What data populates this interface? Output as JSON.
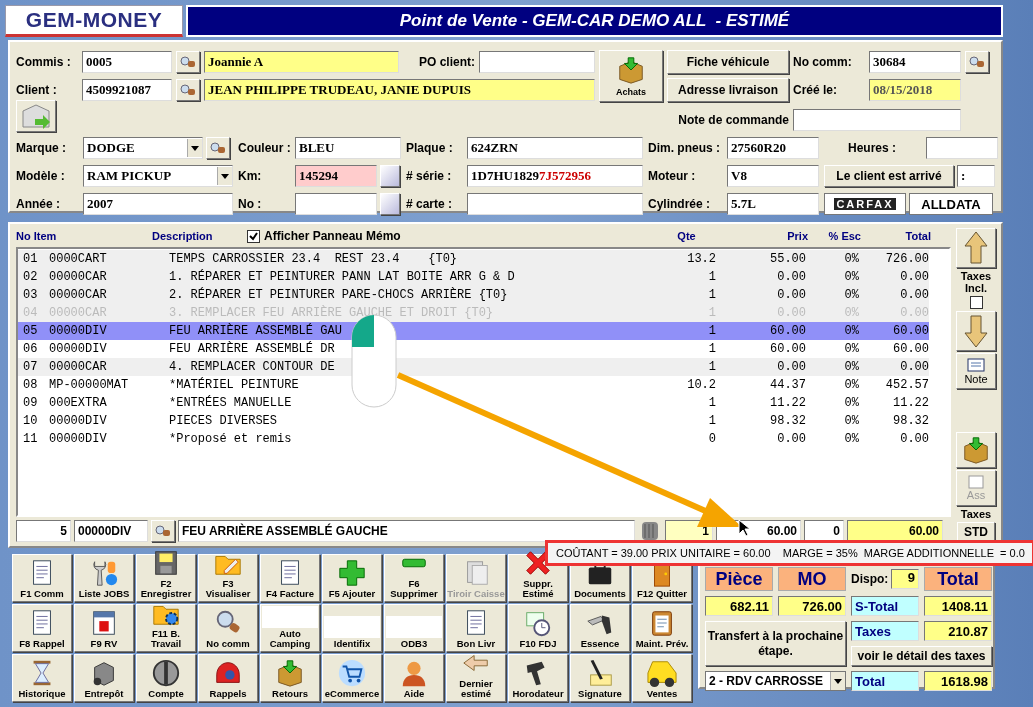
{
  "header": {
    "logo": "GEM-MONEY",
    "title": "Point de Vente - GEM-CAR DEMO ALL  - ESTIMÉ"
  },
  "order": {
    "commis": {
      "label": "Commis :",
      "code": "0005",
      "name": "Joannie A"
    },
    "po_client": {
      "label": "PO client:"
    },
    "client": {
      "label": "Client :",
      "code": "4509921087",
      "name": "JEAN PHILIPPE TRUDEAU, JANIE DUPUIS"
    },
    "achats": "Achats",
    "buttons": [
      "Fiche véhicule",
      "Adresse livraison"
    ],
    "no_comm": {
      "label": "No comm:",
      "value": "30684"
    },
    "created": {
      "label": "Créé le:",
      "value": "08/15/2018"
    },
    "note": {
      "label": "Note de commande"
    }
  },
  "vehicle": {
    "marque": {
      "label": "Marque :",
      "value": "DODGE"
    },
    "modele": {
      "label": "Modèle :",
      "value": "RAM PICKUP"
    },
    "annee": {
      "label": "Année :",
      "value": "2007"
    },
    "couleur": {
      "label": "Couleur :",
      "value": "BLEU"
    },
    "km": {
      "label": "Km:",
      "value": "145294"
    },
    "no": {
      "label": "No :"
    },
    "plaque": {
      "label": "Plaque :",
      "value": "624ZRN"
    },
    "serie": {
      "label": "# série :",
      "value": "1D7HU1829",
      "value_highlight": "7J572956"
    },
    "carte": {
      "label": "# carte :"
    },
    "pneus": {
      "label": "Dim. pneus :",
      "value": "27560R20"
    },
    "moteur": {
      "label": "Moteur :",
      "value": "V8"
    },
    "cylindree": {
      "label": "Cylindrée :",
      "value": "5.7L"
    },
    "heures": {
      "label": "Heures :"
    },
    "arrived_button": "Le client est arrivé",
    "arrived_field": ":",
    "logos": [
      "CARFAX",
      "ALLDATA"
    ]
  },
  "items": {
    "columns": [
      "No Item",
      "Description",
      "Qte",
      "Prix",
      "% Esc",
      "Total"
    ],
    "memo": {
      "label": "Afficher Panneau Mémo",
      "checked": true
    },
    "rows": [
      {
        "no": "01",
        "item": "0000CART",
        "desc": "TEMPS CARROSSIER 23.4  REST 23.4    {T0}",
        "qte": "13.2",
        "prix": "55.00",
        "esc": "0%",
        "total": "726.00",
        "shaded": true,
        "selected": false,
        "disabled": false
      },
      {
        "no": "02",
        "item": "00000CAR",
        "desc": "1. RÉPARER ET PEINTURER PANN LAT BOITE ARR G & D",
        "qte": "1",
        "prix": "0.00",
        "esc": "0%",
        "total": "0.00",
        "shaded": true,
        "selected": false,
        "disabled": false
      },
      {
        "no": "03",
        "item": "00000CAR",
        "desc": "2. RÉPARER ET PEINTURER PARE-CHOCS ARRIÈRE {T0}",
        "qte": "1",
        "prix": "0.00",
        "esc": "0%",
        "total": "0.00",
        "shaded": true,
        "selected": false,
        "disabled": false
      },
      {
        "no": "04",
        "item": "00000CAR",
        "desc": "3. REMPLACER FEU ARRIÈRE GAUCHE ET DROIT {T0}",
        "qte": "1",
        "prix": "0.00",
        "esc": "0%",
        "total": "0.00",
        "shaded": true,
        "selected": false,
        "disabled": true
      },
      {
        "no": "05",
        "item": "00000DIV",
        "desc": "FEU ARRIÈRE ASSEMBLÉ GAU",
        "qte": "1",
        "prix": "60.00",
        "esc": "0%",
        "total": "60.00",
        "shaded": false,
        "selected": true,
        "disabled": false
      },
      {
        "no": "06",
        "item": "00000DIV",
        "desc": "FEU ARRIÈRE ASSEMBLÉ DR",
        "qte": "1",
        "prix": "60.00",
        "esc": "0%",
        "total": "60.00",
        "shaded": false,
        "selected": false,
        "disabled": false
      },
      {
        "no": "07",
        "item": "00000CAR",
        "desc": "4. REMPLACER CONTOUR DE",
        "qte": "1",
        "prix": "0.00",
        "esc": "0%",
        "total": "0.00",
        "shaded": true,
        "selected": false,
        "disabled": false
      },
      {
        "no": "08",
        "item": "MP-00000MAT",
        "desc": "*MATÉRIEL PEINTURE",
        "qte": "10.2",
        "prix": "44.37",
        "esc": "0%",
        "total": "452.57",
        "shaded": false,
        "selected": false,
        "disabled": false
      },
      {
        "no": "09",
        "item": "000EXTRA",
        "desc": "*ENTRÉES MANUELLE",
        "qte": "1",
        "prix": "11.22",
        "esc": "0%",
        "total": "11.22",
        "shaded": false,
        "selected": false,
        "disabled": false
      },
      {
        "no": "10",
        "item": "00000DIV",
        "desc": "PIECES DIVERSES",
        "qte": "1",
        "prix": "98.32",
        "esc": "0%",
        "total": "98.32",
        "shaded": false,
        "selected": false,
        "disabled": false
      },
      {
        "no": "11",
        "item": "00000DIV",
        "desc": "*Proposé et remis",
        "qte": "0",
        "prix": "0.00",
        "esc": "0%",
        "total": "0.00",
        "shaded": false,
        "selected": false,
        "disabled": false
      }
    ],
    "entry": {
      "line": "5",
      "item": "00000DIV",
      "desc": "FEU ARRIÈRE ASSEMBLÉ GAUCHE",
      "qte": "1",
      "prix": "60.00",
      "esc": "0",
      "total": "60.00"
    }
  },
  "side": {
    "taxes_incl": {
      "label": "Taxes Incl.",
      "checked": false
    },
    "note": "Note",
    "ass": "Ass",
    "taxes": "Taxes",
    "std": "STD"
  },
  "tooltip": "COÛTANT = 39.00 PRIX UNITAIRE = 60.00    MARGE = 35%  MARGE ADDITIONNELLE  = 0.0",
  "toolbar": [
    {
      "label": "F1 Comm",
      "kind": "icon",
      "disabled": false
    },
    {
      "label": "Liste JOBS",
      "kind": "icon",
      "disabled": false
    },
    {
      "label": "F2 Enregistrer",
      "kind": "icon",
      "disabled": false
    },
    {
      "label": "F3 Visualiser",
      "kind": "icon",
      "disabled": false
    },
    {
      "label": "F4  Facture",
      "kind": "icon",
      "disabled": false
    },
    {
      "label": "F5  Ajouter",
      "kind": "icon",
      "disabled": false
    },
    {
      "label": "F6 Supprimer",
      "kind": "icon",
      "disabled": false
    },
    {
      "label": "Tiroir Caisse",
      "kind": "icon",
      "disabled": true
    },
    {
      "label": "Suppr. Estimé",
      "kind": "icon",
      "disabled": false
    },
    {
      "label": "Documents",
      "kind": "icon",
      "disabled": false
    },
    {
      "label": "F12 Quitter",
      "kind": "icon",
      "disabled": false
    },
    {
      "label": "F8 Rappel",
      "kind": "icon",
      "disabled": false
    },
    {
      "label": "F9 RV",
      "kind": "icon",
      "disabled": false
    },
    {
      "label": "F11 B. Travail",
      "kind": "icon",
      "disabled": false
    },
    {
      "label": "No comm",
      "kind": "icon",
      "disabled": false
    },
    {
      "label": "Auto Camping",
      "kind": "logo",
      "disabled": false
    },
    {
      "label": "Identifix",
      "kind": "logo",
      "disabled": false
    },
    {
      "label": "ODB3",
      "kind": "logo",
      "disabled": false
    },
    {
      "label": "Bon Livr",
      "kind": "icon",
      "disabled": false
    },
    {
      "label": "F10  FDJ",
      "kind": "icon",
      "disabled": false
    },
    {
      "label": "Essence",
      "kind": "icon",
      "disabled": false
    },
    {
      "label": "Maint. Prév.",
      "kind": "icon",
      "disabled": false
    },
    {
      "label": "Historique",
      "kind": "icon",
      "disabled": false
    },
    {
      "label": "Entrepôt",
      "kind": "icon",
      "disabled": false
    },
    {
      "label": "Compte",
      "kind": "icon",
      "disabled": false
    },
    {
      "label": "Rappels",
      "kind": "icon",
      "disabled": false
    },
    {
      "label": "Retours",
      "kind": "icon",
      "disabled": false
    },
    {
      "label": "eCommerce",
      "kind": "icon",
      "disabled": false
    },
    {
      "label": "Aide",
      "kind": "icon",
      "disabled": false
    },
    {
      "label": "Dernier estimé",
      "kind": "icon",
      "disabled": false
    },
    {
      "label": "Horodateur",
      "kind": "icon",
      "disabled": false
    },
    {
      "label": "Signature",
      "kind": "icon",
      "disabled": false
    },
    {
      "label": "Ventes",
      "kind": "icon",
      "disabled": false
    }
  ],
  "totals": {
    "piece": "Pièce",
    "mo": "MO",
    "dispo": {
      "label": "Dispo:",
      "value": "9"
    },
    "total_head": "Total",
    "piece_value": "682.11",
    "mo_value": "726.00",
    "stotal": {
      "label": "S-Total",
      "value": "1408.11"
    },
    "taxes": {
      "label": "Taxes",
      "value": "210.87"
    },
    "transfer": "Transfert à la prochaine étape.",
    "tax_detail": "voir le détail des taxes",
    "stage": "2 - RDV CARROSSE",
    "total": {
      "label": "Total",
      "value": "1618.98"
    }
  }
}
